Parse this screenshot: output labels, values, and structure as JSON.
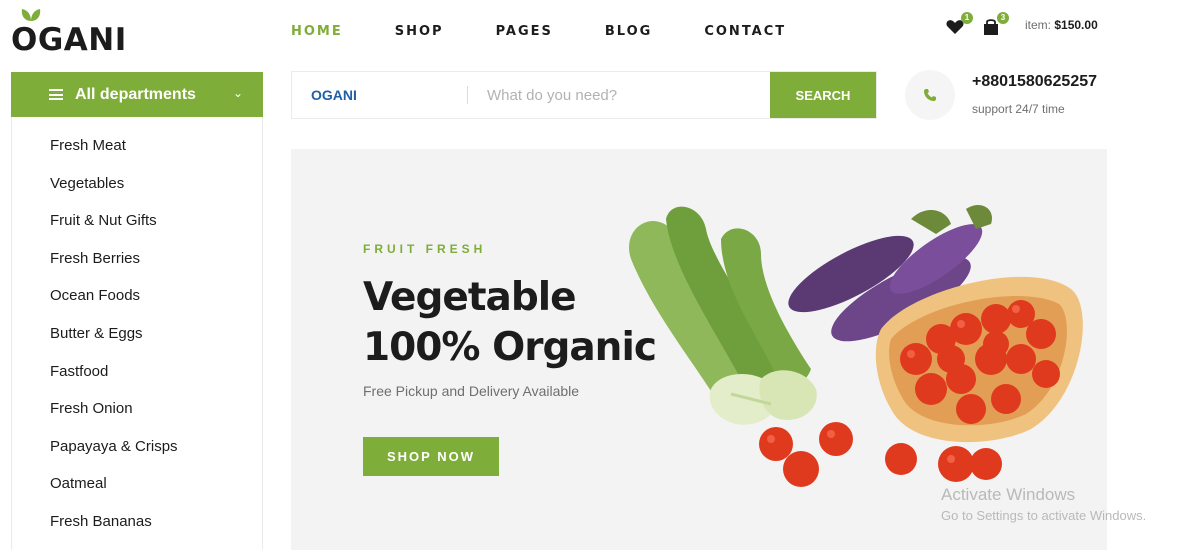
{
  "logo": {
    "text": "OGANI"
  },
  "nav": {
    "items": [
      "HOME",
      "SHOP",
      "PAGES",
      "BLOG",
      "CONTACT"
    ],
    "active": "HOME"
  },
  "header": {
    "wishlist_count": "1",
    "cart_count": "3",
    "cart_label": "item:",
    "cart_total": "$150.00"
  },
  "departments": {
    "title": "All departments",
    "items": [
      "Fresh Meat",
      "Vegetables",
      "Fruit & Nut Gifts",
      "Fresh Berries",
      "Ocean Foods",
      "Butter & Eggs",
      "Fastfood",
      "Fresh Onion",
      "Papayaya & Crisps",
      "Oatmeal",
      "Fresh Bananas"
    ]
  },
  "search": {
    "category": "OGANI",
    "placeholder": "What do you need?",
    "button": "SEARCH"
  },
  "contact": {
    "phone": "+8801580625257",
    "support": "support 24/7 time"
  },
  "hero": {
    "eyebrow": "FRUIT FRESH",
    "title_line1": "Vegetable",
    "title_line2": "100% Organic",
    "subtitle": "Free Pickup and Delivery Available",
    "button": "SHOP NOW"
  },
  "watermark": {
    "line1": "Activate Windows",
    "line2": "Go to Settings to activate Windows."
  },
  "colors": {
    "accent": "#7fad39",
    "text": "#1c1c1c",
    "muted": "#6f6f6f",
    "hero_bg": "#f3f3f3"
  }
}
